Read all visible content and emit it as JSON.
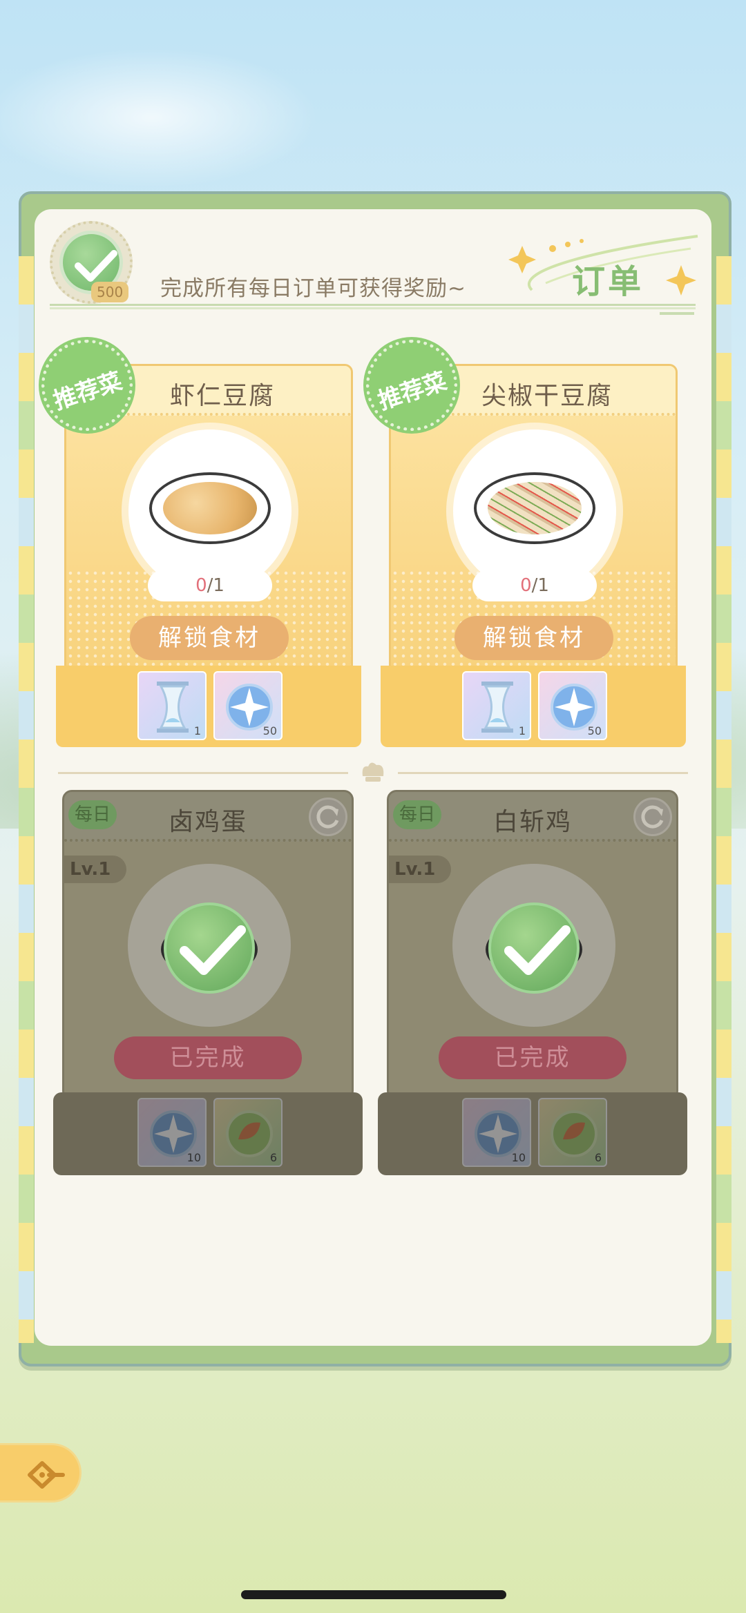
{
  "header": {
    "badge_count": "500",
    "subtitle": "完成所有每日订单可获得奖励~",
    "title": "订单"
  },
  "recommended_orders": [
    {
      "tag": "推荐菜",
      "dish_name": "虾仁豆腐",
      "progress_current": "0",
      "progress_total": "/1",
      "button_label": "解锁食材",
      "rewards": [
        {
          "icon": "hourglass-icon",
          "qty": "1"
        },
        {
          "icon": "compass-star-icon",
          "qty": "50"
        }
      ]
    },
    {
      "tag": "推荐菜",
      "dish_name": "尖椒干豆腐",
      "progress_current": "0",
      "progress_total": "/1",
      "button_label": "解锁食材",
      "rewards": [
        {
          "icon": "hourglass-icon",
          "qty": "1"
        },
        {
          "icon": "compass-star-icon",
          "qty": "50"
        }
      ]
    }
  ],
  "daily_orders": [
    {
      "tag": "每日",
      "dish_name": "卤鸡蛋",
      "level": "Lv.1",
      "button_label": "已完成",
      "rewards": [
        {
          "icon": "compass-star-icon",
          "qty": "10"
        },
        {
          "icon": "leaf-orb-icon",
          "qty": "6"
        }
      ]
    },
    {
      "tag": "每日",
      "dish_name": "白斩鸡",
      "level": "Lv.1",
      "button_label": "已完成",
      "rewards": [
        {
          "icon": "compass-star-icon",
          "qty": "10"
        },
        {
          "icon": "leaf-orb-icon",
          "qty": "6"
        }
      ]
    }
  ],
  "colors": {
    "accent_green": "#87bd73",
    "card_yellow": "#f8d27c",
    "unlock_orange": "#e9b070",
    "done_red": "#a24f5b"
  }
}
